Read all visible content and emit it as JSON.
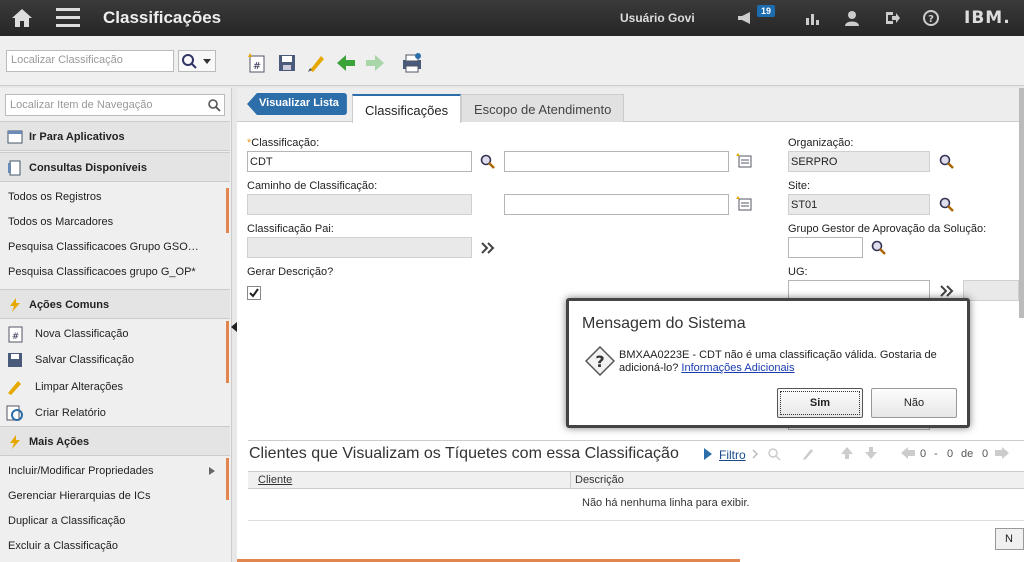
{
  "header": {
    "title": "Classificações",
    "user": "Usuário Govi",
    "notifications_count": "19",
    "brand": "IBM."
  },
  "toolbar": {
    "search_placeholder": "Localizar Classificação"
  },
  "sidebar": {
    "search_placeholder": "Localizar Item de Navegação",
    "goto_apps": "Ir Para Aplicativos",
    "queries_title": "Consultas Disponíveis",
    "queries": [
      "Todos os Registros",
      "Todos os Marcadores",
      "Pesquisa Classificacoes Grupo GSO…",
      "Pesquisa Classificacoes grupo G_OP*"
    ],
    "common_title": "Ações Comuns",
    "common": [
      "Nova Classificação",
      "Salvar Classificação",
      "Limpar Alterações",
      "Criar Relatório"
    ],
    "more_title": "Mais Ações",
    "more": [
      "Incluir/Modificar Propriedades",
      "Gerenciar Hierarquias de ICs",
      "Duplicar a Classificação",
      "Excluir a Classificação"
    ]
  },
  "main": {
    "back_button": "Visualizar Lista",
    "tabs": [
      "Classificações",
      "Escopo de Atendimento"
    ],
    "fields": {
      "classificacao_label": "Classificação:",
      "classificacao_value": "CDT",
      "caminho_label": "Caminho de Classificação:",
      "pai_label": "Classificação Pai:",
      "gerar_label": "Gerar Descrição?",
      "org_label": "Organização:",
      "org_value": "SERPRO",
      "site_label": "Site:",
      "site_value": "ST01",
      "grupo_label": "Grupo Gestor de Aprovação da Solução:",
      "ug_label": "UG:"
    },
    "table": {
      "title": "Clientes que Visualizam os Tíquetes com essa Classificação",
      "filter": "Filtro",
      "pager_from": "0",
      "pager_sep": "-",
      "pager_to": "0",
      "pager_of": "de",
      "pager_total": "0",
      "columns": [
        "Cliente",
        "Descrição"
      ],
      "empty_message": "Não há nenhuma linha para exibir.",
      "new_row_button": "N"
    }
  },
  "dialog": {
    "title": "Mensagem do Sistema",
    "message": "BMXAA0223E - CDT não é uma classificação válida. Gostaria de adicioná-lo?",
    "link": "Informações Adicionais",
    "yes": "Sim",
    "no": "Não"
  },
  "colors": {
    "accent": "#2b6ea9",
    "required": "#e69a21",
    "highlight": "#e0864e"
  }
}
